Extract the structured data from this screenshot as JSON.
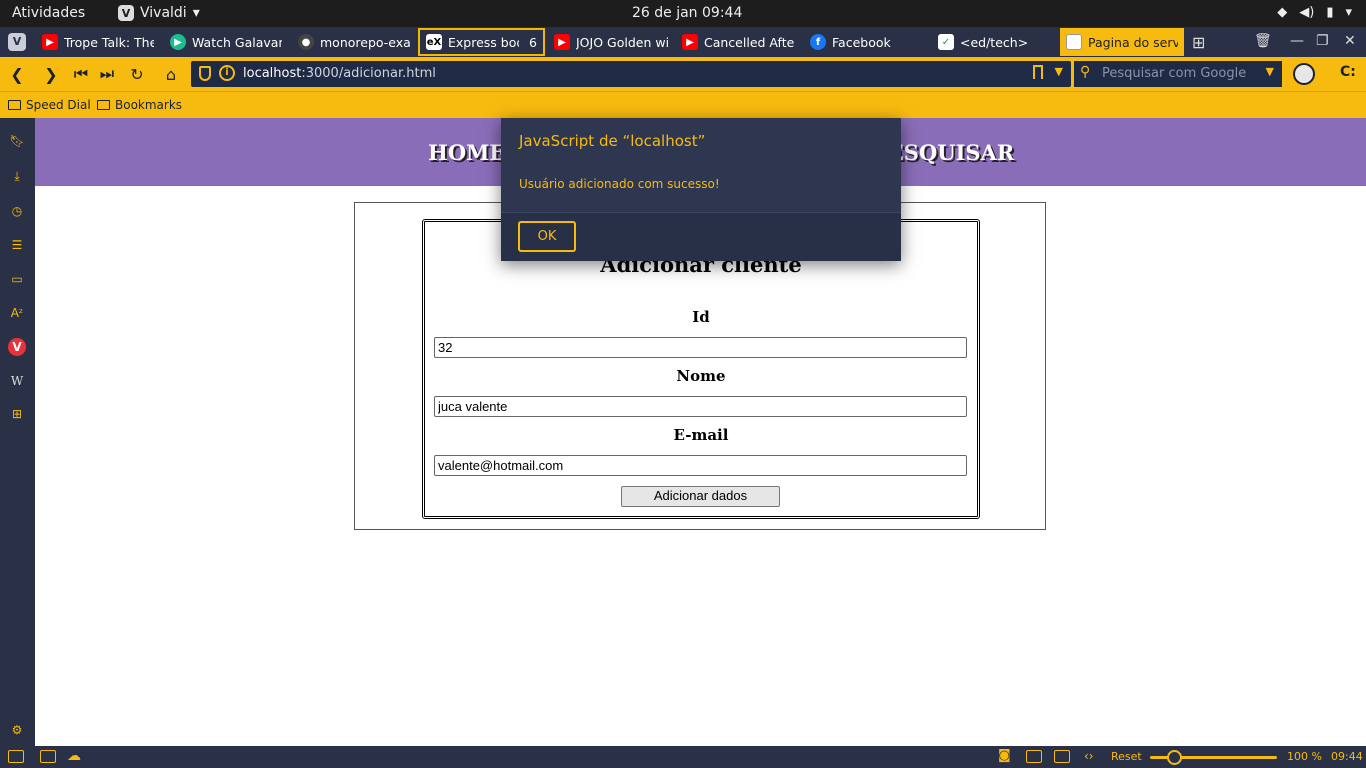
{
  "os_bar": {
    "activities": "Atividades",
    "app_name": "Vivaldi",
    "clock": "26 de jan  09:44"
  },
  "tabs": [
    {
      "label": "Trope Talk: The S",
      "icon": "youtube-icon",
      "icon_color": "#ff0000"
    },
    {
      "label": "Watch Galavant -",
      "icon": "play-icon",
      "icon_color": "#1bbf8b"
    },
    {
      "label": "monorepo-examp",
      "icon": "github-icon",
      "icon_color": "#444444"
    },
    {
      "label": "Express body",
      "icon": "express-icon",
      "icon_color": "#ffffff",
      "count": "6"
    },
    {
      "label": "JOJO Golden win",
      "icon": "youtube-icon",
      "icon_color": "#ff0000"
    },
    {
      "label": "Cancelled After",
      "icon": "youtube-icon",
      "icon_color": "#ff0000"
    },
    {
      "label": "Facebook",
      "icon": "facebook-icon",
      "icon_color": "#1877f2"
    },
    {
      "label": "<ed/tech>",
      "icon": "edtech-icon",
      "icon_color": "#2e8b57"
    },
    {
      "label": "Pagina do servidor",
      "icon": "page-icon",
      "icon_color": "#ffffff"
    }
  ],
  "address": {
    "host": "localhost",
    "path": ":3000/adicionar.html",
    "search_placeholder": "Pesquisar com Google"
  },
  "bookmarks": {
    "speed_dial": "Speed Dial",
    "bookmarks": "Bookmarks"
  },
  "page": {
    "nav": {
      "home": "HOME",
      "search": "PESQUISAR"
    },
    "form": {
      "title": "Adicionar cliente",
      "id_label": "Id",
      "id_value": "32",
      "name_label": "Nome",
      "name_value": "juca valente",
      "email_label": "E-mail",
      "email_value": "valente@hotmail.com",
      "submit": "Adicionar dados"
    }
  },
  "dialog": {
    "title": "JavaScript de “localhost”",
    "message": "Usuário adicionado com sucesso!",
    "ok": "OK"
  },
  "status_bar": {
    "reset": "Reset",
    "zoom": "100 %",
    "zoom_fraction": 0.2,
    "time": "09:44"
  },
  "colors": {
    "accent": "#f7bb10",
    "chrome": "#2a3146",
    "page_nav": "#8a6db8"
  }
}
